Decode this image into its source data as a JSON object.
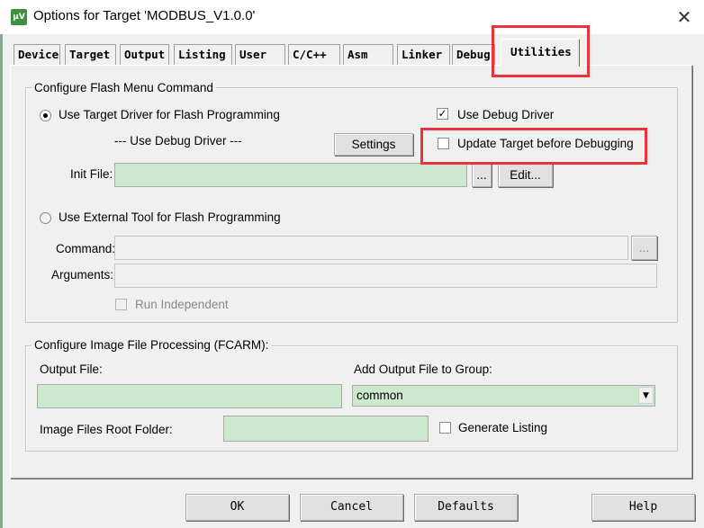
{
  "window": {
    "title": "Options for Target 'MODBUS_V1.0.0'",
    "icon": "keil-uvision-icon",
    "icon_text": "µV",
    "close_glyph": "✕"
  },
  "tabs": [
    {
      "label": "Device"
    },
    {
      "label": "Target"
    },
    {
      "label": "Output"
    },
    {
      "label": "Listing"
    },
    {
      "label": "User"
    },
    {
      "label": "C/C++"
    },
    {
      "label": "Asm"
    },
    {
      "label": "Linker"
    },
    {
      "label": "Debug"
    },
    {
      "label": "Utilities",
      "active": true
    }
  ],
  "flash": {
    "group_title": "Configure Flash Menu Command",
    "use_target_driver_label": "Use Target Driver for Flash Programming",
    "use_target_driver_selected": true,
    "use_debug_driver_label": "Use Debug Driver",
    "use_debug_driver_checked": true,
    "debug_driver_note": "--- Use Debug Driver ---",
    "settings_button": "Settings",
    "update_target_label": "Update Target before Debugging",
    "update_target_checked": false,
    "init_file_label": "Init File:",
    "init_file_value": "",
    "browse_button": "...",
    "edit_button": "Edit...",
    "use_external_tool_label": "Use External Tool for Flash Programming",
    "use_external_tool_selected": false,
    "command_label": "Command:",
    "command_value": "",
    "command_browse_button": "...",
    "arguments_label": "Arguments:",
    "arguments_value": "",
    "run_independent_label": "Run Independent",
    "run_independent_checked": false
  },
  "image": {
    "group_title": "Configure Image File Processing (FCARM):",
    "output_file_label": "Output File:",
    "output_file_value": "",
    "add_output_label": "Add Output File  to Group:",
    "group_select_value": "common",
    "root_folder_label": "Image Files Root Folder:",
    "root_folder_value": "",
    "generate_listing_label": "Generate Listing",
    "generate_listing_checked": false
  },
  "footer": {
    "ok": "OK",
    "cancel": "Cancel",
    "defaults": "Defaults",
    "help": "Help"
  },
  "colors": {
    "field_background": "#cce8cf",
    "highlight_annotation": "#e8333a"
  }
}
